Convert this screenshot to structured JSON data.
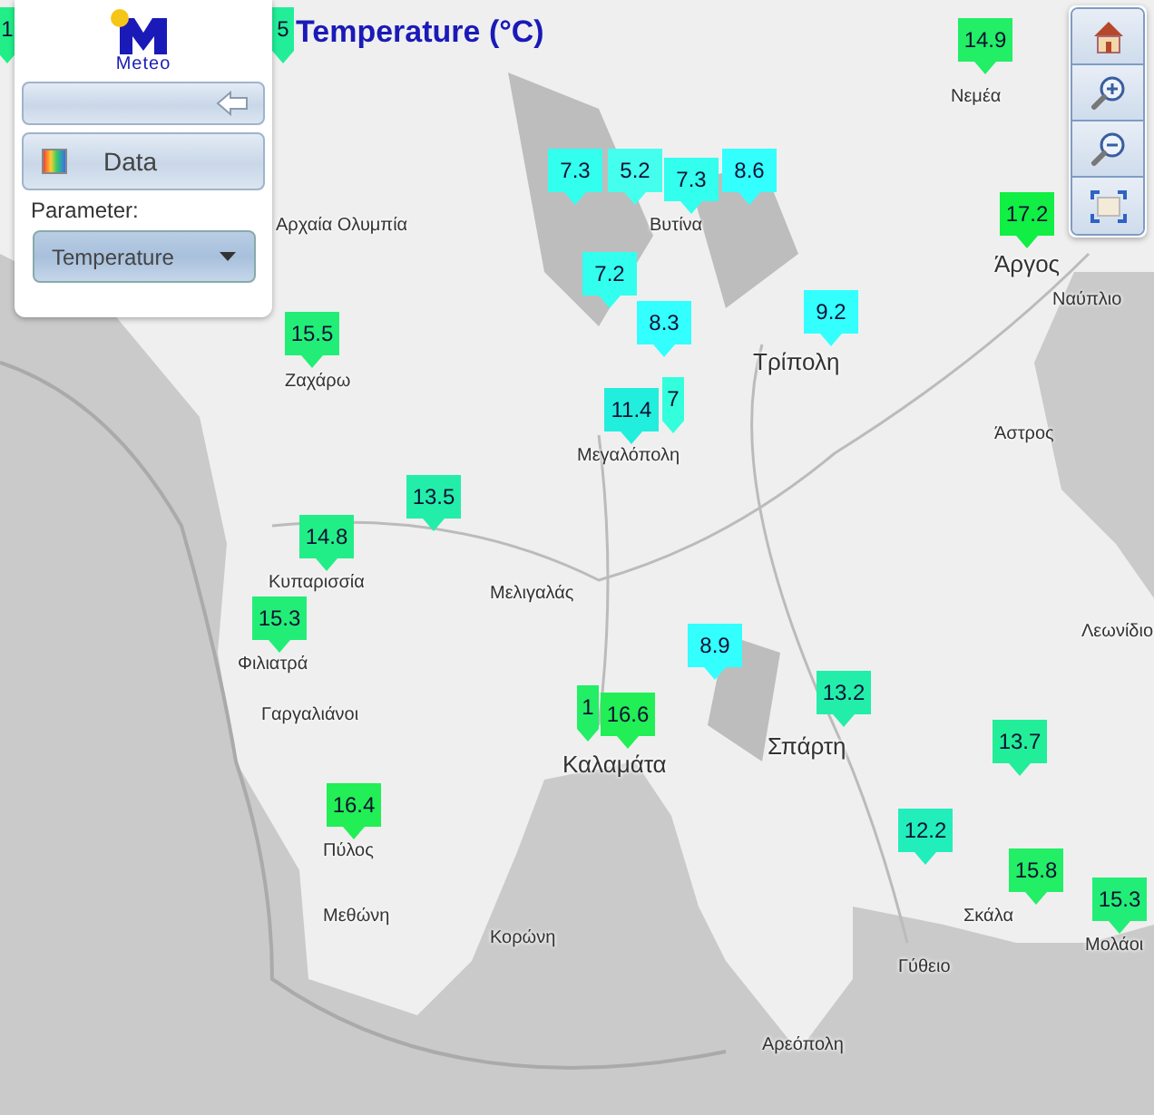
{
  "title": "Temperature (°C)",
  "logo": {
    "text": "Meteo"
  },
  "panel": {
    "data_button": "Data",
    "parameter_label": "Parameter:",
    "parameter_select": "Temperature"
  },
  "stations": [
    {
      "value": "1",
      "color": "#22ee88",
      "kind": "partial"
    },
    {
      "value": "5",
      "color": "#22ee99",
      "kind": "partial"
    },
    {
      "value": "14.9",
      "color": "#22ee66",
      "kind": "full"
    },
    {
      "value": "7.3",
      "color": "#33ffee",
      "kind": "full"
    },
    {
      "value": "5.2",
      "color": "#44ffee",
      "kind": "full"
    },
    {
      "value": "7.3",
      "color": "#33ffee",
      "kind": "full"
    },
    {
      "value": "8.6",
      "color": "#33ffff",
      "kind": "full"
    },
    {
      "value": "17.2",
      "color": "#11ee44",
      "kind": "full"
    },
    {
      "value": "7.2",
      "color": "#33ffee",
      "kind": "full"
    },
    {
      "value": "8.3",
      "color": "#33ffff",
      "kind": "full"
    },
    {
      "value": "9.2",
      "color": "#33ffff",
      "kind": "full"
    },
    {
      "value": "15.5",
      "color": "#22ee77",
      "kind": "full"
    },
    {
      "value": "7",
      "color": "#33ffdd",
      "kind": "partial"
    },
    {
      "value": "11.4",
      "color": "#22eedd",
      "kind": "full"
    },
    {
      "value": "13.5",
      "color": "#22eeaa",
      "kind": "full"
    },
    {
      "value": "14.8",
      "color": "#22ee88",
      "kind": "full"
    },
    {
      "value": "15.3",
      "color": "#22ee77",
      "kind": "full"
    },
    {
      "value": "8.9",
      "color": "#33ffff",
      "kind": "full"
    },
    {
      "value": "13.2",
      "color": "#22eeaa",
      "kind": "full"
    },
    {
      "value": "1",
      "color": "#22ee66",
      "kind": "partial"
    },
    {
      "value": "16.6",
      "color": "#22ee55",
      "kind": "full"
    },
    {
      "value": "13.7",
      "color": "#22ee99",
      "kind": "full"
    },
    {
      "value": "16.4",
      "color": "#22ee55",
      "kind": "full"
    },
    {
      "value": "12.2",
      "color": "#22eebb",
      "kind": "full"
    },
    {
      "value": "15.8",
      "color": "#22ee66",
      "kind": "full"
    },
    {
      "value": "15.3",
      "color": "#22ee77",
      "kind": "full"
    }
  ],
  "places": [
    "Νεμέα",
    "Βυτίνα",
    "Άργος",
    "Ναύπλιο",
    "Αρχαία Ολυμπία",
    "Τρίπολη",
    "Ζαχάρω",
    "Άστρος",
    "Μεγαλόπολη",
    "Κυπαρισσία",
    "Μελιγαλάς",
    "Φιλιατρά",
    "Λεωνίδιο",
    "Σπάρτη",
    "Γαργαλιάνοι",
    "Καλαμάτα",
    "Πύλος",
    "Σκάλα",
    "Μεθώνη",
    "Μολάοι",
    "Κορώνη",
    "Γύθειο",
    "Αρεόπολη"
  ]
}
